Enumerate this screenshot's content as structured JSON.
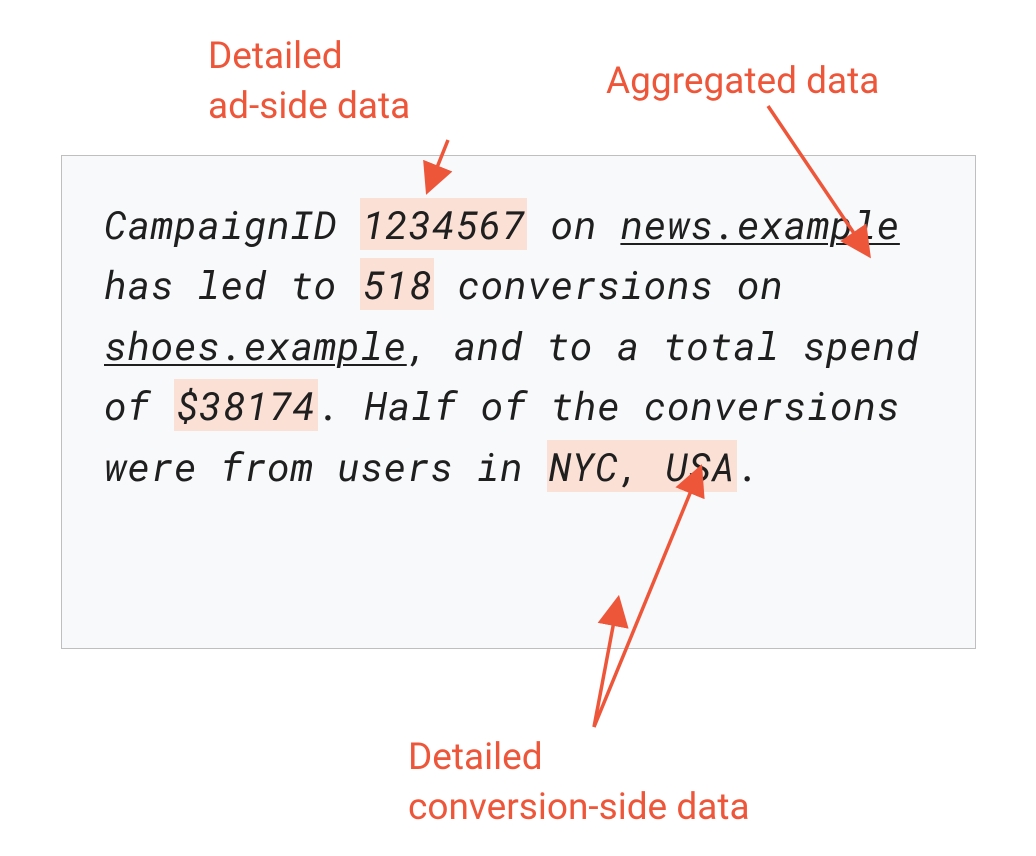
{
  "labels": {
    "ad_side_line1": "Detailed",
    "ad_side_line2": "ad-side data",
    "aggregated": "Aggregated data",
    "conv_side_line1": "Detailed",
    "conv_side_line2": "conversion-side data"
  },
  "paragraph": {
    "t0": "CampaignID ",
    "campaign_id": "1234567",
    "t1": " on ",
    "publisher": "news.example",
    "t2": " has led to ",
    "conversions": "518",
    "t3": " conversions on ",
    "advertiser": "shoes.example",
    "t4": ", and to a total spend of ",
    "spend": "$38174",
    "t5": ". Half of the conversions were from users in ",
    "location": "NYC, USA",
    "t6": "."
  },
  "colors": {
    "accent": "#ee563a",
    "highlight_bg": "#fbe0d6",
    "card_bg": "#f8f9fb",
    "card_border": "#bfbfbf",
    "text": "#1f1f1f"
  }
}
